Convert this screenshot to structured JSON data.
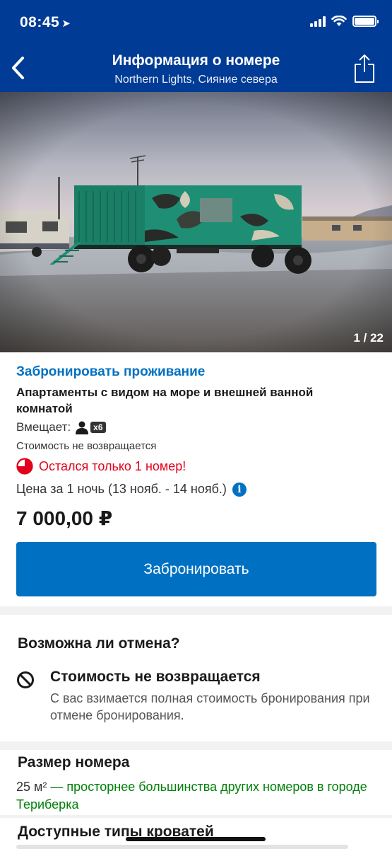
{
  "status": {
    "time": "08:45"
  },
  "nav": {
    "title": "Информация о номере",
    "subtitle": "Northern Lights, Сияние севера"
  },
  "gallery": {
    "counter": "1 / 22"
  },
  "room": {
    "book_link": "Забронировать проживание",
    "name": "Апартаменты с видом на море и внешней ванной комнатой",
    "capacity_label": "Вмещает:",
    "capacity_count": "x6",
    "refund_note": "Стоимость не возвращается",
    "urgency": "Остался только 1 номер!",
    "price_label": "Цена за 1 ночь (13 нояб. - 14 нояб.)",
    "price": "7 000,00 ₽",
    "book_button": "Забронировать"
  },
  "cancellation": {
    "title": "Возможна ли отмена?",
    "policy_title": "Стоимость не возвращается",
    "policy_desc": "С вас взимается полная стоимость бронирования при отмене бронирования."
  },
  "room_size": {
    "title": "Размер номера",
    "value": "25 м²",
    "comparison": "— просторнее большинства других номеров в городе Териберка"
  },
  "beds": {
    "title": "Доступные типы кроватей"
  },
  "colors": {
    "header_bg": "#003b95",
    "accent": "#0071c2",
    "urgent": "#e3001b",
    "positive": "#008009"
  }
}
